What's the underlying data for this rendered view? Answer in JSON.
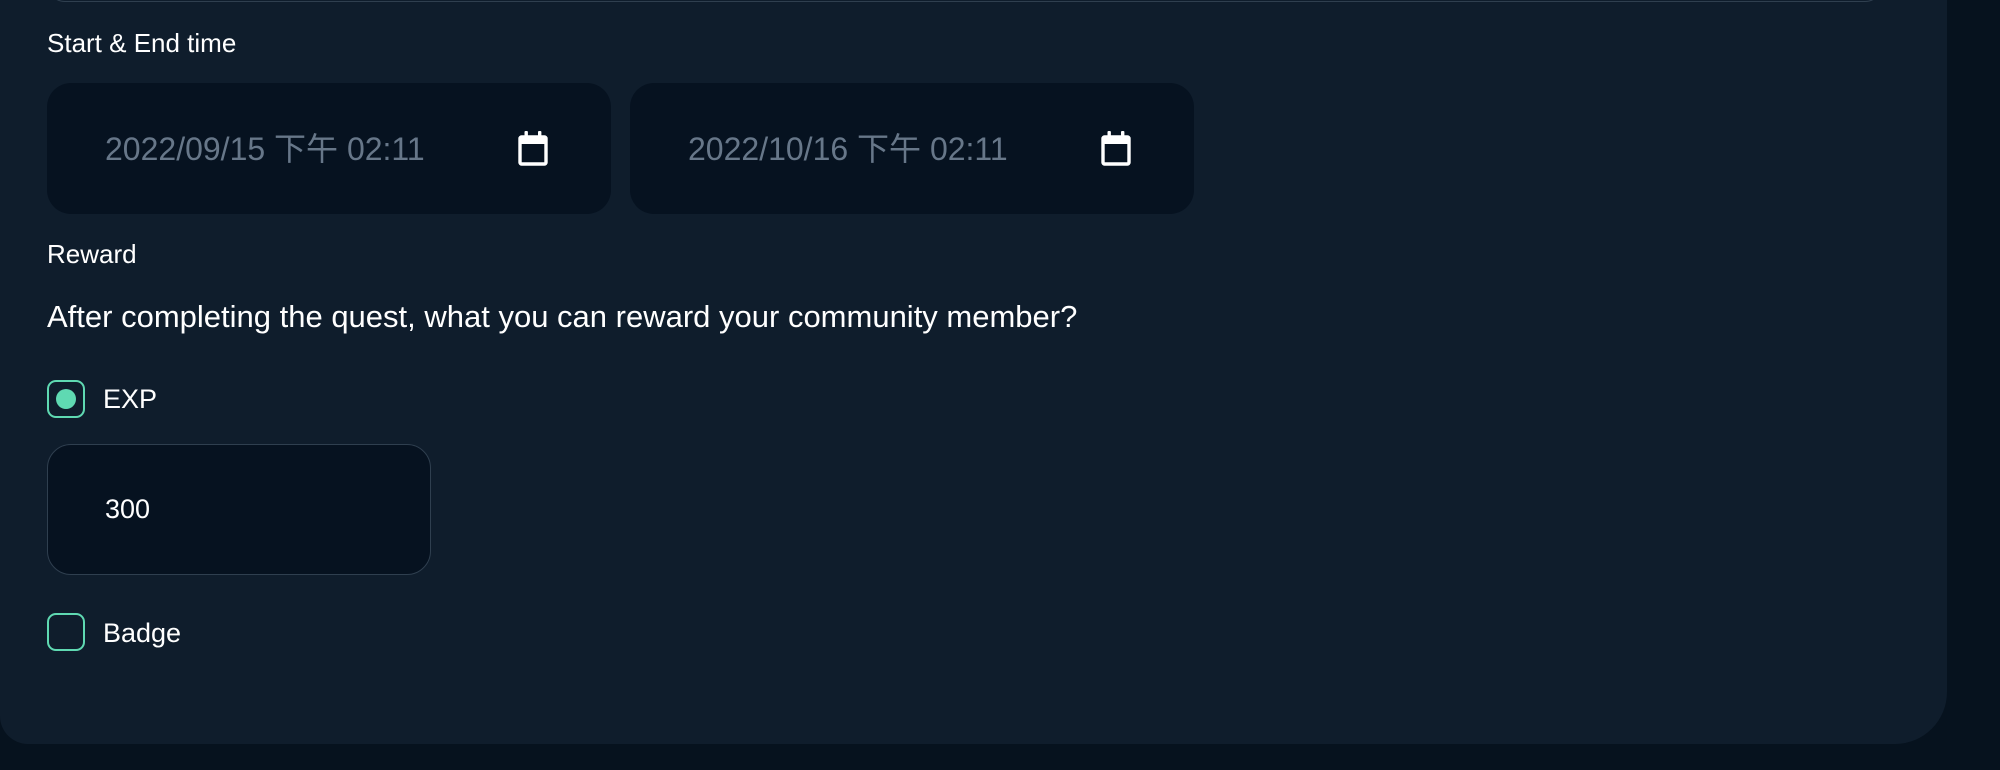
{
  "schedule": {
    "label": "Start & End time",
    "start_value": "2022/09/15  下午 02:11",
    "end_value": "2022/10/16  下午 02:11",
    "calendar_icon": "calendar-icon"
  },
  "reward": {
    "label": "Reward",
    "question": "After completing the quest, what you can reward your community member?",
    "exp": {
      "label": "EXP",
      "checked": true,
      "value": "300"
    },
    "badge": {
      "label": "Badge",
      "checked": false
    }
  },
  "colors": {
    "accent": "#5fd9b2",
    "panel": "#0f1d2c",
    "field": "#061220",
    "page": "#06121e",
    "muted_text": "#677789"
  }
}
